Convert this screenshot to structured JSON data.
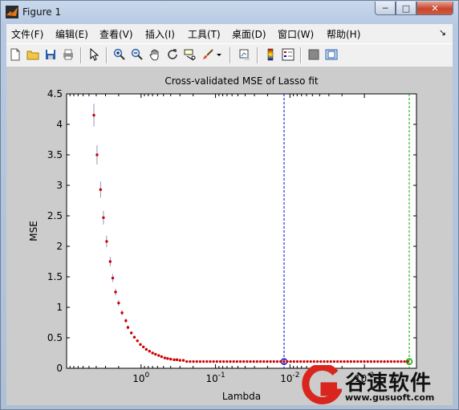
{
  "window": {
    "title": "Figure 1"
  },
  "menubar": {
    "items": [
      "文件(F)",
      "编辑(E)",
      "查看(V)",
      "插入(I)",
      "工具(T)",
      "桌面(D)",
      "窗口(W)",
      "帮助(H)"
    ]
  },
  "toolbar": {
    "icons": [
      "new-figure-icon",
      "open-file-icon",
      "save-icon",
      "print-icon",
      "select-arrow-icon",
      "zoom-in-icon",
      "zoom-out-icon",
      "pan-hand-icon",
      "rotate-3d-icon",
      "data-cursor-icon",
      "brush-icon",
      "brush-dropdown-icon",
      "link-plot-icon",
      "colorbar-icon",
      "legend-icon",
      "hide-plot-tools-icon",
      "show-plot-tools-icon"
    ]
  },
  "chart_data": {
    "type": "scatter",
    "title": "Cross-validated MSE of Lasso fit",
    "xlabel": "Lambda",
    "ylabel": "MSE",
    "x_axis": "log10 lambda, reversed (large on left)",
    "xlim": [
      10,
      0.0002
    ],
    "ylim": [
      0,
      4.5
    ],
    "yticks": [
      "0",
      "0.5",
      "1",
      "1.5",
      "2",
      "2.5",
      "3",
      "3.5",
      "4",
      "4.5"
    ],
    "xticks": [
      "10^0",
      "10^-1",
      "10^-2",
      "10^-3"
    ],
    "series": [
      {
        "marker": "red dot with error bar",
        "color": "#cc0000",
        "lambda": [
          4.3,
          3.9,
          3.5,
          3.2,
          2.9,
          2.6,
          2.4,
          2.2,
          2.0,
          1.8,
          1.6,
          1.5,
          1.35,
          1.23,
          1.12,
          1.02,
          0.93,
          0.85,
          0.77,
          0.7,
          0.64,
          0.58,
          0.53,
          0.48,
          0.44,
          0.4,
          0.36,
          0.33,
          0.3,
          0.27
        ],
        "mse": [
          4.15,
          3.5,
          2.93,
          2.47,
          2.08,
          1.75,
          1.48,
          1.25,
          1.07,
          0.91,
          0.78,
          0.67,
          0.58,
          0.51,
          0.45,
          0.39,
          0.35,
          0.31,
          0.28,
          0.25,
          0.23,
          0.21,
          0.19,
          0.17,
          0.16,
          0.15,
          0.14,
          0.14,
          0.13,
          0.13
        ],
        "flat_tail_mse": 0.11
      }
    ],
    "vlines": [
      {
        "lambda": 0.012,
        "color": "#0000cc",
        "style": "dashed",
        "marker": "blue circle"
      },
      {
        "lambda": 0.00025,
        "color": "#00aa00",
        "style": "dashed",
        "marker": "green circle"
      }
    ],
    "grid": false,
    "legend": "none"
  },
  "watermark": {
    "brand": "谷速软件",
    "url": "www.gusuoft.com"
  }
}
